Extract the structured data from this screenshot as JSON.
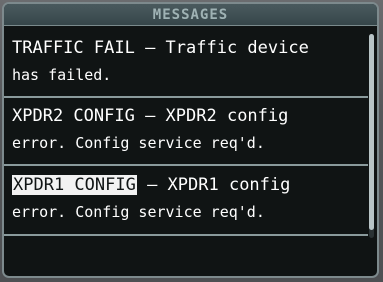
{
  "window": {
    "title": "MESSAGES"
  },
  "messages": [
    {
      "code": "TRAFFIC FAIL",
      "separator": " – ",
      "text_line1": "Traffic device",
      "text_line2": "has failed."
    },
    {
      "code": "XPDR2 CONFIG",
      "separator": " – ",
      "text_line1": "XPDR2 config",
      "text_line2": "error. Config service req'd."
    },
    {
      "code": "XPDR1 CONFIG",
      "separator": " – ",
      "text_line1": "XPDR1 config",
      "text_line2": "error. Config service req'd."
    }
  ],
  "colors": {
    "background": "#101414",
    "text": "#ffffff",
    "highlight_bg": "#f2f2f2",
    "title_text": "#9fb2b4",
    "border": "#7d8a8d"
  }
}
